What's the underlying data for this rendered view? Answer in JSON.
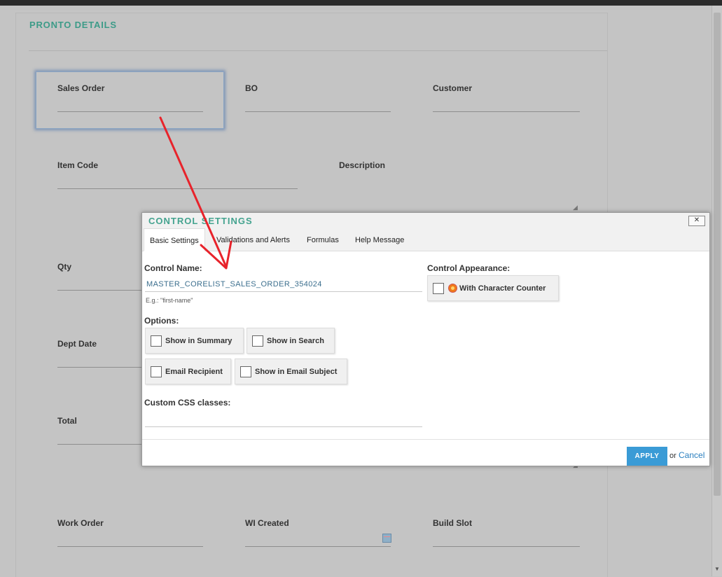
{
  "form": {
    "title": "PRONTO DETAILS",
    "fields": {
      "sales_order": "Sales Order",
      "bo": "BO",
      "customer": "Customer",
      "item_code": "Item Code",
      "description": "Description",
      "qty": "Qty",
      "dept_date": "Dept Date",
      "total": "Total",
      "work_order": "Work Order",
      "wi_created": "WI Created",
      "build_slot": "Build Slot"
    }
  },
  "dialog": {
    "title": "CONTROL SETTINGS",
    "close_label": "✕",
    "tabs": [
      "Basic Settings",
      "Validations and Alerts",
      "Formulas",
      "Help Message"
    ],
    "control_name_label": "Control Name:",
    "control_name_value": "MASTER_CORELIST_SALES_ORDER_354024",
    "control_name_hint": "E.g.: \"first-name\"",
    "options_label": "Options:",
    "options": {
      "show_in_summary": "Show in Summary",
      "show_in_search": "Show in Search",
      "email_recipient": "Email Recipient",
      "show_in_email_subject": "Show in Email Subject"
    },
    "custom_css_label": "Custom CSS classes:",
    "control_appearance_label": "Control Appearance:",
    "with_character_counter": "With Character Counter",
    "apply_label": "APPLY",
    "or_text": "or",
    "cancel_label": "Cancel"
  },
  "colors": {
    "accent_teal": "#3d9b88",
    "apply_blue": "#3a9bd6",
    "arrow_red": "#e8232b"
  },
  "icons": [
    "calendar-icon",
    "character-counter-icon",
    "close-icon",
    "annotation-arrow"
  ]
}
